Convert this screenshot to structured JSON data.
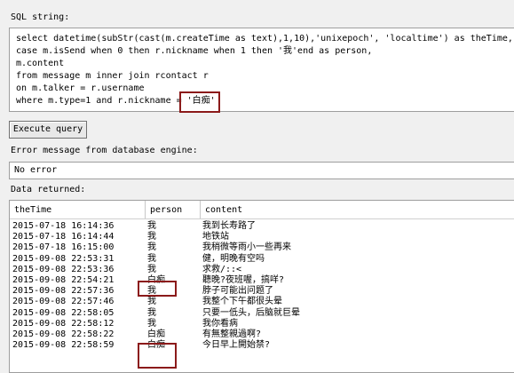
{
  "labels": {
    "sql": "SQL string:",
    "error": "Error message from database engine:",
    "data": "Data returned:"
  },
  "sql_lines": [
    "select datetime(subStr(cast(m.createTime as text),1,10),'unixepoch', 'localtime') as theTime,",
    "case m.isSend when 0 then r.nickname when 1 then '我'end as person,",
    "m.content",
    "from message m inner join rcontact r",
    "on m.talker = r.username",
    "where m.type=1 and r.nickname = '白痴'"
  ],
  "execute_button": "Execute query",
  "error_value": "No error",
  "grid": {
    "columns": [
      "theTime",
      "person",
      "content"
    ],
    "rows": [
      [
        "2015-07-18 16:14:36",
        "我",
        "我到长寿路了"
      ],
      [
        "2015-07-18 16:14:44",
        "我",
        "地铁站"
      ],
      [
        "2015-07-18 16:15:00",
        "我",
        "我稍微等雨小一些再来"
      ],
      [
        "2015-09-08 22:53:31",
        "我",
        "健，明晚有空吗"
      ],
      [
        "2015-09-08 22:53:36",
        "我",
        "求救/::<"
      ],
      [
        "2015-09-08 22:54:21",
        "白痴",
        "聽晚?夜班喔，搞咩?"
      ],
      [
        "2015-09-08 22:57:36",
        "我",
        "脖子可能出问题了"
      ],
      [
        "2015-09-08 22:57:46",
        "我",
        "我整个下午都很头晕"
      ],
      [
        "2015-09-08 22:58:05",
        "我",
        "只要一低头，后脑就巨晕"
      ],
      [
        "2015-09-08 22:58:12",
        "我",
        "我你看病"
      ],
      [
        "2015-09-08 22:58:22",
        "白痴",
        "有無整親過啊?"
      ],
      [
        "2015-09-08 22:58:59",
        "白痴",
        "今日早上開始禁?"
      ]
    ]
  }
}
